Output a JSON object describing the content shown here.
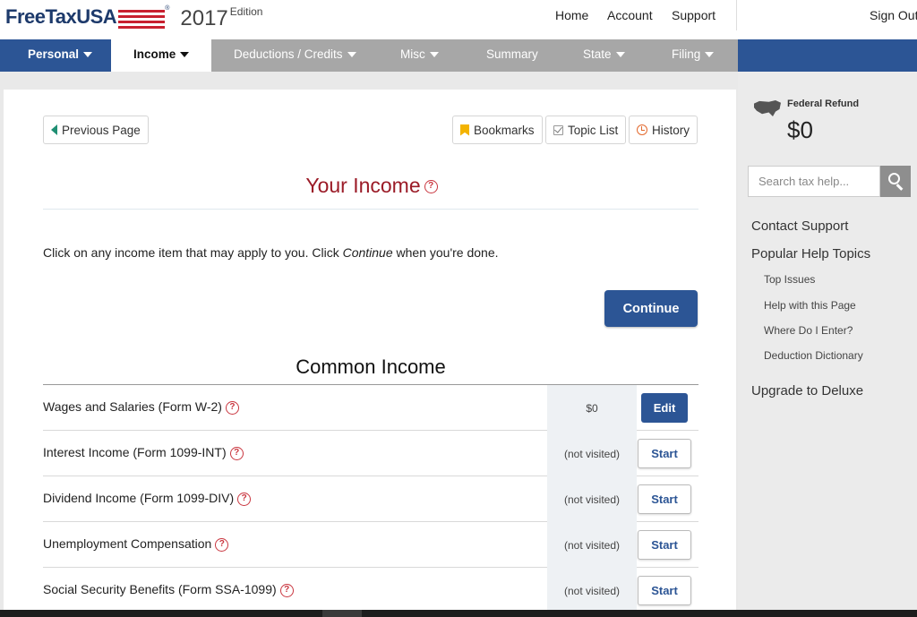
{
  "header": {
    "logo_text": "FreeTaxUSA",
    "logo_reg": "®",
    "year": "2017",
    "edition": "Edition",
    "links": [
      "Home",
      "Account",
      "Support"
    ],
    "sign_out": "Sign Out"
  },
  "nav": {
    "items": [
      {
        "label": "Personal",
        "active": false
      },
      {
        "label": "Income",
        "active": true
      },
      {
        "label": "Deductions / Credits",
        "active": false
      },
      {
        "label": "Misc",
        "active": false
      },
      {
        "label": "Summary",
        "active": false
      },
      {
        "label": "State",
        "active": false
      },
      {
        "label": "Filing",
        "active": false
      }
    ]
  },
  "toolbar": {
    "previous_page": "Previous Page",
    "bookmarks": "Bookmarks",
    "topic_list": "Topic List",
    "history": "History"
  },
  "main": {
    "title": "Your Income",
    "help_glyph": "?",
    "intro_before": "Click on any income item that may apply to you. Click ",
    "intro_em": "Continue",
    "intro_after": " when you're done.",
    "continue_label": "Continue",
    "section_title": "Common Income",
    "rows": [
      {
        "label": "Wages and Salaries (Form W-2)",
        "status": "$0",
        "action": "Edit"
      },
      {
        "label": "Interest Income (Form 1099-INT)",
        "status": "(not visited)",
        "action": "Start"
      },
      {
        "label": "Dividend Income (Form 1099-DIV)",
        "status": "(not visited)",
        "action": "Start"
      },
      {
        "label": "Unemployment Compensation",
        "status": "(not visited)",
        "action": "Start"
      },
      {
        "label": "Social Security Benefits (Form SSA-1099)",
        "status": "(not visited)",
        "action": "Start"
      }
    ]
  },
  "sidebar": {
    "refund_label": "Federal Refund",
    "refund_value": "$0",
    "search_placeholder": "Search tax help...",
    "contact_support": "Contact Support",
    "popular_topics": "Popular Help Topics",
    "topics": [
      "Top Issues",
      "Help with this Page",
      "Where Do I Enter?",
      "Deduction Dictionary"
    ],
    "upgrade": "Upgrade to Deluxe"
  },
  "colors": {
    "brand_blue": "#2c5595",
    "title_red": "#9b1b27",
    "nav_gray": "#a7a7a7"
  }
}
